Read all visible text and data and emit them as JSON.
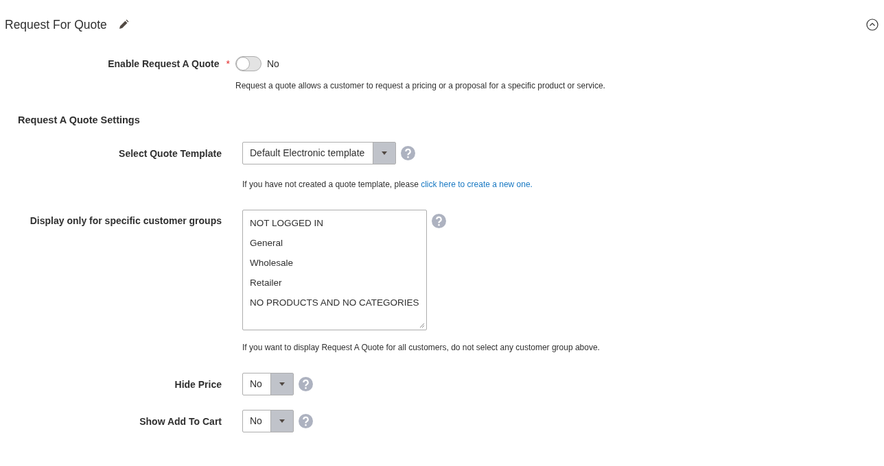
{
  "section": {
    "title": "Request For Quote",
    "expanded": true
  },
  "enable": {
    "label": "Enable Request A Quote",
    "required_mark": "*",
    "on": false,
    "state_text": "No",
    "note": "Request a quote allows a customer to request a pricing or a proposal for a specific product or service."
  },
  "subsection": "Request A Quote Settings",
  "fields": [
    {
      "kind": "select",
      "label": "Select Quote Template",
      "value": "Default Electronic template",
      "note": "If you have not created a quote template, please ",
      "link": "click here to create a new one."
    },
    {
      "kind": "multiselect",
      "label": "Display only for specific customer groups",
      "options": [
        {
          "label": "NOT LOGGED IN",
          "selected": false
        },
        {
          "label": "General",
          "selected": false
        },
        {
          "label": "Wholesale",
          "selected": false
        },
        {
          "label": "Retailer",
          "selected": false
        },
        {
          "label": "NO PRODUCTS AND NO CATEGORIES",
          "selected": false
        }
      ],
      "note": "If you want to display Request A Quote for all customers, do not select any customer group above."
    },
    {
      "kind": "select",
      "label": "Hide Price",
      "value": "No"
    },
    {
      "kind": "select",
      "label": "Show Add To Cart",
      "value": "No"
    }
  ]
}
